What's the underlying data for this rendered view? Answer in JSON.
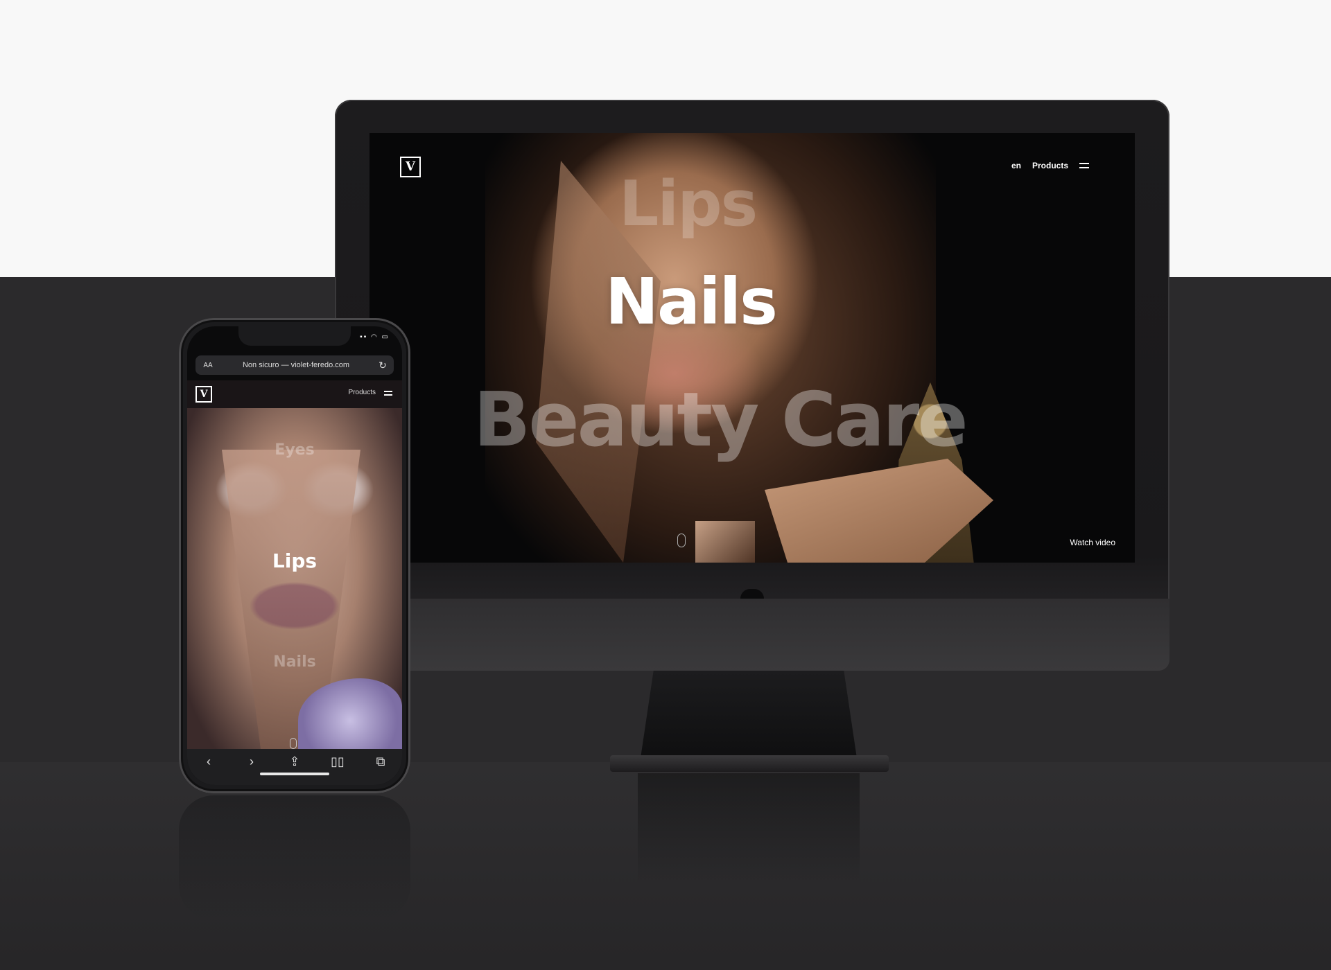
{
  "desktop": {
    "logo": "V",
    "nav": {
      "lang": "en",
      "products": "Products"
    },
    "words": {
      "lips": "Lips",
      "nails": "Nails",
      "beauty": "Beauty Care"
    },
    "watch_video": "Watch video"
  },
  "phone": {
    "url_aa": "AA",
    "url": "Non sicuro — violet-feredo.com",
    "logo": "V",
    "products": "Products",
    "words": {
      "eyes": "Eyes",
      "lips": "Lips",
      "nails": "Nails"
    },
    "toolbar": {
      "back": "‹",
      "forward": "›",
      "share": "⇪",
      "bookmarks": "▯▯",
      "tabs": "⧉"
    }
  },
  "colors": {
    "background_top": "#f8f8f8",
    "background_bottom": "#2b2a2c"
  }
}
